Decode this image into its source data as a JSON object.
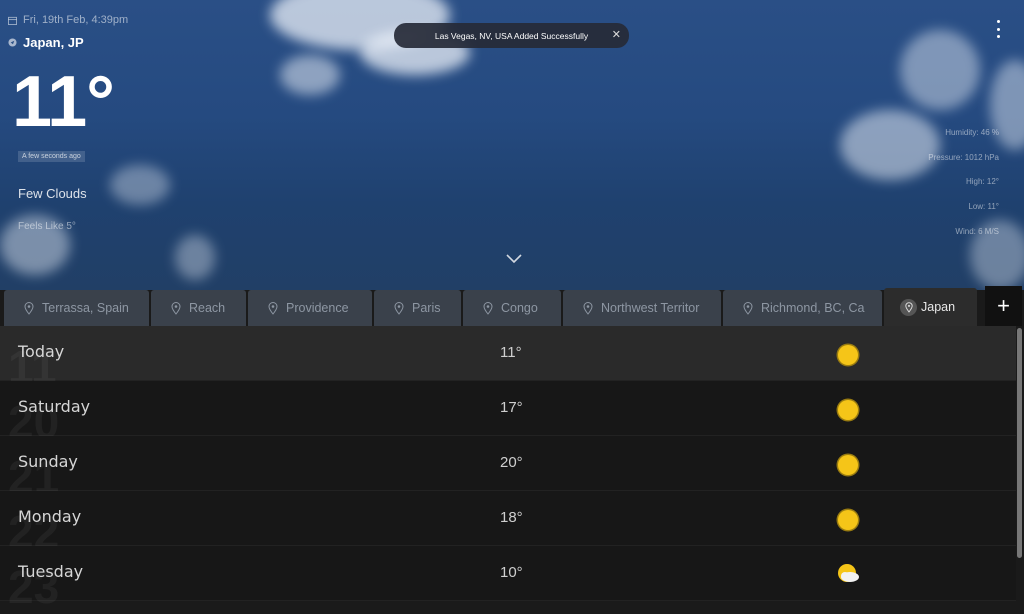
{
  "header": {
    "date": "Fri, 19th Feb, 4:39pm",
    "location": "Japan, JP",
    "temperature": "11°",
    "updated": "A few seconds ago",
    "condition": "Few Clouds",
    "feels_like": "Feels Like 5°"
  },
  "stats": {
    "humidity": "Humidity: 46 %",
    "pressure": "Pressure: 1012 hPa",
    "high": "High: 12°",
    "low": "Low: 11°",
    "wind": "Wind: 6 M/S"
  },
  "toast": {
    "message": "Las Vegas, NV, USA Added Successfully",
    "close": "✕"
  },
  "tabs": [
    {
      "label": "Terrassa, Spain"
    },
    {
      "label": "Reach"
    },
    {
      "label": "Providence"
    },
    {
      "label": "Paris"
    },
    {
      "label": "Congo"
    },
    {
      "label": "Northwest Territor"
    },
    {
      "label": "Richmond, BC, Ca"
    },
    {
      "label": "Japan"
    }
  ],
  "add_label": "+",
  "forecast": [
    {
      "day": "Today",
      "temp": "11°",
      "icon": "sun-icon",
      "bg": "11"
    },
    {
      "day": "Saturday",
      "temp": "17°",
      "icon": "sun-icon",
      "bg": "20"
    },
    {
      "day": "Sunday",
      "temp": "20°",
      "icon": "sun-icon",
      "bg": "21"
    },
    {
      "day": "Monday",
      "temp": "18°",
      "icon": "sun-icon",
      "bg": "22"
    },
    {
      "day": "Tuesday",
      "temp": "10°",
      "icon": "partly-cloudy-icon",
      "bg": "23"
    }
  ],
  "colors": {
    "sun": "#f5c518",
    "tab_active": "#2c2c2c",
    "list_bg": "#171717"
  }
}
